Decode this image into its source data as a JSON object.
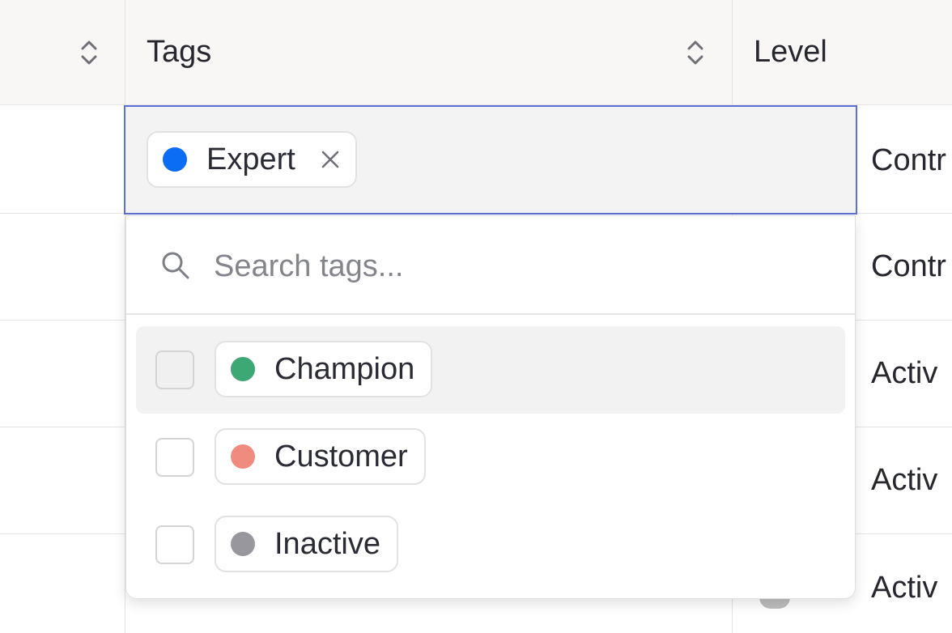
{
  "table": {
    "header": {
      "tags_label": "Tags",
      "level_label": "Level"
    },
    "level_column": [
      "Contr",
      "Contr",
      "Activ",
      "Activ",
      "Activ"
    ]
  },
  "tag_editor": {
    "selected_tags": [
      {
        "label": "Expert",
        "color": "#0b6cf4"
      }
    ]
  },
  "dropdown": {
    "search_placeholder": "Search tags...",
    "options": [
      {
        "label": "Champion",
        "color": "#3da874",
        "checked": false,
        "hovered": true
      },
      {
        "label": "Customer",
        "color": "#f08b80",
        "checked": false,
        "hovered": false
      },
      {
        "label": "Inactive",
        "color": "#97979d",
        "checked": false,
        "hovered": false
      }
    ]
  },
  "colors": {
    "accent_border": "#5b6fd6",
    "header_background": "#f8f7f5"
  }
}
